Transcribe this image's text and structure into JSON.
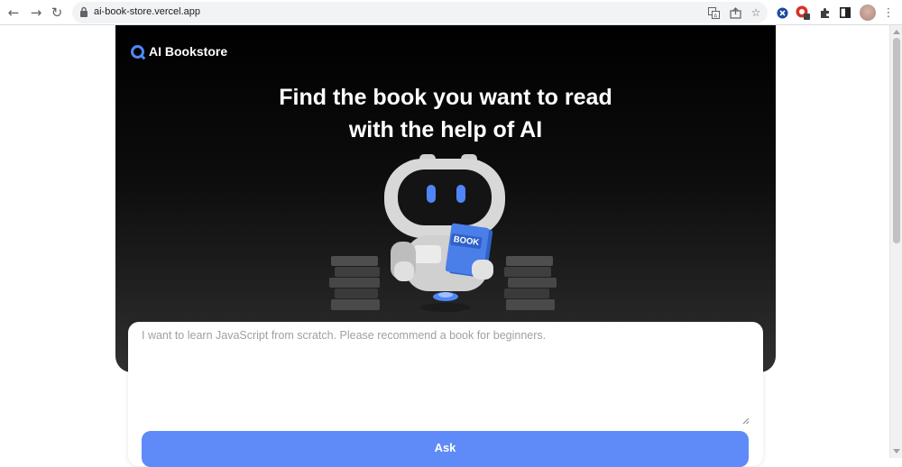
{
  "browser": {
    "url": "ai-book-store.vercel.app",
    "icons": [
      "back-icon",
      "forward-icon",
      "reload-icon",
      "lock-icon",
      "translate-icon",
      "share-icon",
      "bookmark-star-icon",
      "extension-icon",
      "extension-badge-icon",
      "puzzle-icon",
      "side-panel-icon",
      "profile-avatar",
      "menu-icon"
    ],
    "extension_badge_count": "1"
  },
  "header": {
    "logo_text": "AI Bookstore"
  },
  "hero": {
    "headline_line1": "Find the book you want to read",
    "headline_line2": "with the help of AI",
    "book_label": "BOOK"
  },
  "query": {
    "placeholder": "I want to learn JavaScript from scratch. Please recommend a book for beginners.",
    "value": ""
  },
  "ask_button": {
    "label": "Ask"
  },
  "colors": {
    "accent": "#5e8bf7",
    "brand_blue": "#4f86f7",
    "hero_bg": "#000000"
  }
}
